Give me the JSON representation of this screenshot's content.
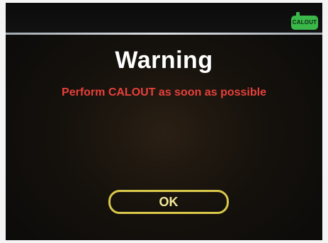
{
  "header": {
    "status_badge": "CALOUT",
    "status_color": "#3ab84a",
    "status_icon": "calout-indicator-icon"
  },
  "dialog": {
    "title": "Warning",
    "message": "Perform CALOUT as soon as possible",
    "message_color": "#e8403a",
    "ok_label": "OK",
    "ok_border_color": "#d9c84a"
  }
}
